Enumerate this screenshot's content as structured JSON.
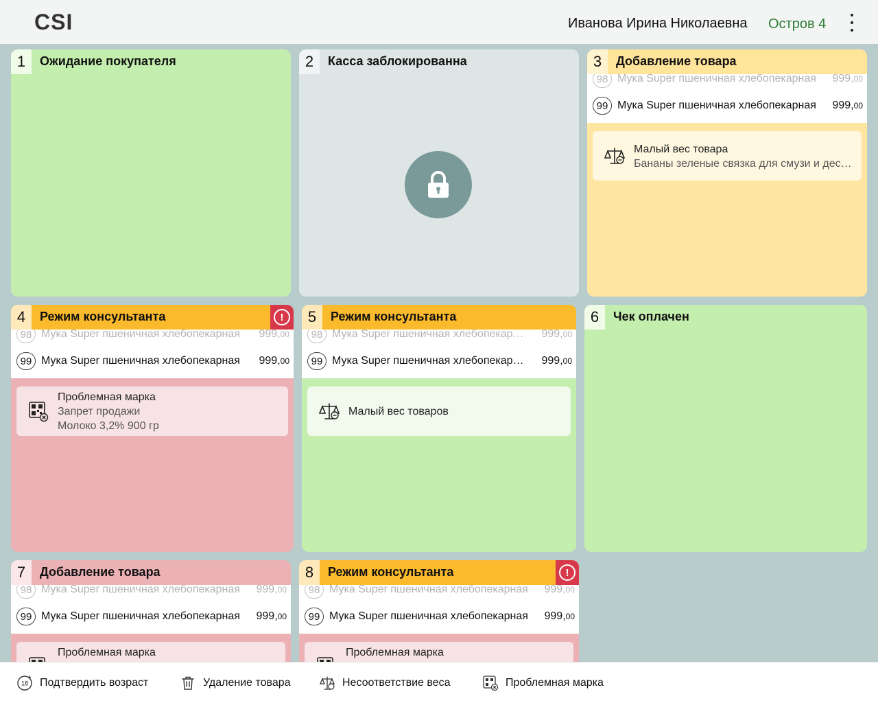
{
  "header": {
    "logo": "CSI",
    "user_name": "Иванова Ирина Николаевна",
    "island": "Остров 4"
  },
  "tiles": [
    {
      "number": "1",
      "status": "Ожидание покупателя",
      "color": "#c4eeae"
    },
    {
      "number": "2",
      "status": "Касса заблокированна",
      "color": "#dde5e5",
      "icon": "lock-icon"
    },
    {
      "number": "3",
      "status": "Добавление товара",
      "color": "#ffe6a0",
      "items": [
        {
          "qty": "98",
          "name": "Мука Super пшеничная хлебопекарная",
          "price_main": "999,",
          "price_kop": "00"
        },
        {
          "qty": "99",
          "name": "Мука Super пшеничная хлебопекарная",
          "price_main": "999,",
          "price_kop": "00"
        }
      ],
      "card": {
        "icon": "scale-icon",
        "title": "Малый вес товара",
        "lines": [
          "Бананы зеленые связка для смузи и десертов"
        ]
      }
    },
    {
      "number": "4",
      "status": "Режим консультанта",
      "color": "#ebb1b5",
      "alert": true,
      "items": [
        {
          "qty": "98",
          "name": "Мука Super пшеничная хлебопекарная",
          "price_main": "999,",
          "price_kop": "00"
        },
        {
          "qty": "99",
          "name": "Мука Super пшеничная хлебопекарная",
          "price_main": "999,",
          "price_kop": "00"
        }
      ],
      "card": {
        "icon": "qr-code-icon",
        "title": "Проблемная марка",
        "lines": [
          "Запрет продажи",
          "Молоко 3,2% 900 гр"
        ]
      }
    },
    {
      "number": "5",
      "status": "Режим консультанта",
      "color": "#c4eeae",
      "items": [
        {
          "qty": "98",
          "name": "Мука Super пшеничная хлебопекарная",
          "price_main": "999,",
          "price_kop": "00"
        },
        {
          "qty": "99",
          "name": "Мука Super пшеничная хлебопекарная",
          "price_main": "999,",
          "price_kop": "00"
        }
      ],
      "card": {
        "icon": "scale-icon",
        "title": "Малый вес товаров",
        "lines": []
      }
    },
    {
      "number": "6",
      "status": "Чек оплачен",
      "color": "#c4eeae"
    },
    {
      "number": "7",
      "status": "Добавление товара",
      "color": "#ebb1b5",
      "items": [
        {
          "qty": "98",
          "name": "Мука Super пшеничная хлебопекарная",
          "price_main": "999,",
          "price_kop": "00"
        },
        {
          "qty": "99",
          "name": "Мука Super пшеничная хлебопекарная",
          "price_main": "999,",
          "price_kop": "00"
        }
      ],
      "card": {
        "icon": "qr-code-icon",
        "title": "Проблемная марка",
        "lines": []
      }
    },
    {
      "number": "8",
      "status": "Режим консультанта",
      "color": "#ebb1b5",
      "alert": true,
      "items": [
        {
          "qty": "98",
          "name": "Мука Super пшеничная хлебопекарная",
          "price_main": "999,",
          "price_kop": "00"
        },
        {
          "qty": "99",
          "name": "Мука Super пшеничная хлебопекарная",
          "price_main": "999,",
          "price_kop": "00"
        }
      ],
      "card": {
        "icon": "qr-code-icon",
        "title": "Проблемная марка",
        "lines": []
      }
    }
  ],
  "bottom_actions": [
    {
      "label": "Подтвердить возраст",
      "icon": "age-18-icon",
      "badge": "18"
    },
    {
      "label": "Удаление товара",
      "icon": "trash-icon"
    },
    {
      "label": "Несоответствие веса",
      "icon": "scale-icon"
    },
    {
      "label": "Проблемная марка",
      "icon": "qr-code-icon"
    }
  ],
  "colors": {
    "accent_green": "#2e7d32",
    "header_orange": "#fbb92c",
    "alert_red": "#d8394a",
    "background": "#b8cccc"
  }
}
